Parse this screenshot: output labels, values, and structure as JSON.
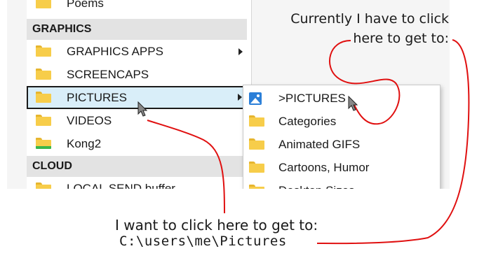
{
  "menu": {
    "partial_top_item": "Poems",
    "sections": [
      {
        "header": "GRAPHICS",
        "items": [
          {
            "label": "GRAPHICS APPS",
            "icon": "folder-icon",
            "has_submenu": true
          },
          {
            "label": "SCREENCAPS",
            "icon": "folder-icon",
            "has_submenu": false
          },
          {
            "label": "PICTURES",
            "icon": "folder-icon",
            "has_submenu": true,
            "highlighted": true
          },
          {
            "label": "VIDEOS",
            "icon": "folder-icon",
            "has_submenu": false
          },
          {
            "label": "Kong2",
            "icon": "folder-green-icon",
            "has_submenu": false
          }
        ]
      },
      {
        "header": "CLOUD",
        "items": [
          {
            "label": "LOCAL SEND buffer",
            "icon": "folder-icon",
            "has_submenu": false
          }
        ]
      }
    ]
  },
  "submenu": {
    "items": [
      {
        "label": ">PICTURES",
        "icon": "picture-icon"
      },
      {
        "label": "Categories",
        "icon": "folder-icon"
      },
      {
        "label": "Animated GIFS",
        "icon": "folder-icon"
      },
      {
        "label": "Cartoons, Humor",
        "icon": "folder-icon"
      },
      {
        "label": "Desktop Sizes",
        "icon": "folder-icon"
      }
    ]
  },
  "annotations": {
    "top_line1": "Currently I have to click",
    "top_line2": "here to get to:",
    "bottom_line1": "I want to click here to get to:",
    "bottom_path": "C:\\users\\me\\Pictures"
  },
  "colors": {
    "highlight_bg": "#d9eef9",
    "header_bg": "#e3e3e3",
    "arrow_line": "#e01010",
    "folder": "#f7cd4a",
    "picture_icon": "#2b7fd8"
  }
}
